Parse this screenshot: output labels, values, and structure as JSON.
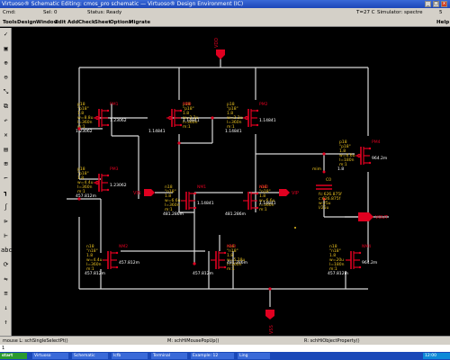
{
  "window": {
    "title": "Virtuoso® Schematic Editing: cmos_pro schematic — Virtuoso® Design Environment (IC)",
    "minimize": "_",
    "maximize": "□",
    "close": "x"
  },
  "status": {
    "cmd_label": "Cmd:",
    "sel_label": "Sel: 0",
    "status_label": "Status: Ready",
    "temp_label": "T=27 C",
    "simulator_label": "Simulator: spectre",
    "corner": "5"
  },
  "menu": {
    "items": [
      "Tools",
      "Design",
      "Window",
      "Edit",
      "Add",
      "Check",
      "Sheet",
      "Options",
      "Migrate"
    ],
    "help": "Help"
  },
  "toolbar": {
    "icons": [
      "check-icon",
      "save-icon",
      "zoom-in-icon",
      "zoom-out-icon",
      "stretch-icon",
      "copy-icon",
      "undo-icon",
      "delete-icon",
      "properties-icon",
      "instance-icon",
      "wire-icon",
      "wide-wire-icon",
      "label-icon",
      "pin-icon",
      "cmd-icon",
      "abc-icon",
      "rotate-icon",
      "mirror-icon",
      "bus-icon",
      "descend-icon",
      "ascend-icon"
    ]
  },
  "schematic": {
    "pins": {
      "vdd": "VDD",
      "vss": "VSS",
      "vin": "VIN",
      "vip": "VIP",
      "vout": "VOUT"
    },
    "transistors": {
      "pm1": {
        "name": "PM1",
        "model": "\"p18\"",
        "type": "p18",
        "ratio": "1.8",
        "w": "w=8.8u",
        "l": "l=360n",
        "m": "m:1",
        "v1": "1.23062",
        "v2": "1.23062"
      },
      "pm0": {
        "name": "PM0",
        "model": "\"p18\"",
        "type": "p18",
        "ratio": "1.8",
        "w": "w=2.2u",
        "l": "l=360n",
        "m": "m:1",
        "v1": "1.14841",
        "v2": "1.14841"
      },
      "pm2": {
        "name": "PM2",
        "model": "\"p18\"",
        "type": "p18",
        "ratio": "1.8",
        "w": "w=2.2u",
        "l": "l=360n",
        "m": "m:1",
        "v1": "1.14841",
        "v2": "1.14841"
      },
      "pm3": {
        "name": "PM3",
        "model": "\"p18\"",
        "type": "p18",
        "ratio": "1.8",
        "w": "w=4.4u",
        "l": "l=360n",
        "m": "m:1",
        "v1": "1.23062",
        "v2": "457.812m"
      },
      "pm4": {
        "name": "PM4",
        "model": "\"p18\"",
        "type": "p18",
        "ratio": "1.8",
        "w": "w=6.6u",
        "l": "l=180n",
        "m": "m:1",
        "v1": "964.2m",
        "v2": "1.8"
      },
      "nm1": {
        "name": "NM1",
        "model": "\"n18\"",
        "type": "n18",
        "ratio": "1.8",
        "w": "w=6.6u",
        "l": "l=360n",
        "m": "m:1",
        "v1": "1.14841",
        "v2": "481.286m"
      },
      "nm0": {
        "name": "NM0",
        "model": "\"n18\"",
        "type": "n18",
        "ratio": "1.8",
        "w": "w=6.6u",
        "l": "l=360n",
        "m": "m:1",
        "v1": "1.14841",
        "v2": "481.286m"
      },
      "nm2": {
        "name": "NM2",
        "model": "\"n18\"",
        "type": "n18",
        "ratio": "1.8",
        "w": "w=4.4u",
        "l": "l=360n",
        "m": "m:1",
        "v1": "457.812m",
        "v2": "457.812m"
      },
      "nm3": {
        "name": "NM3",
        "model": "\"n18\"",
        "type": "n18",
        "ratio": "1.8",
        "w": "w=5.28u",
        "l": "l=360n",
        "m": "m:1",
        "v1": "481.286m",
        "v2": "457.812m"
      },
      "nm4": {
        "name": "NM4",
        "model": "\"n18\"",
        "type": "n18",
        "ratio": "1.8",
        "w": "w=20u",
        "l": "l=180n",
        "m": "m:1",
        "v1": "964.2m",
        "v2": "457.812m"
      }
    },
    "capacitor": {
      "name": "C0",
      "model": "mim",
      "c": "fc:626.875f",
      "c2": "c:626.875f",
      "w": "w:25u",
      "l": "l/25u"
    }
  },
  "mouse": {
    "left": "mouse L: schSingleSelectPt()",
    "mid": "M: schHiMousePopUp()",
    "right": "R: schHiObjectProperty()"
  },
  "cmdline": "1",
  "taskbar": {
    "start": "start",
    "items": [
      "Virtuoso",
      "Schematic",
      "Icfb",
      "Terminal",
      "Example: 12",
      "Ling"
    ],
    "clock": "12:00"
  }
}
